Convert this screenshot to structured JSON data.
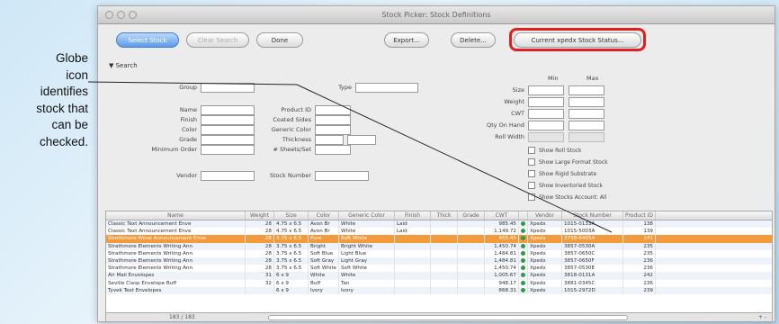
{
  "callout": {
    "lines": [
      "Globe",
      "icon",
      "identifies",
      "stock that",
      "can be",
      "checked."
    ]
  },
  "window": {
    "title": "Stock Picker: Stock Definitions"
  },
  "toolbar": {
    "select_stock": "Select Stock",
    "clear_search": "Clear Search",
    "done": "Done",
    "export": "Export...",
    "delete": "Delete...",
    "current_status": "Current xpedx Stock Status..."
  },
  "search": {
    "toggle": "▼ Search",
    "min_header": "Min",
    "max_header": "Max",
    "labels": {
      "group": "Group",
      "name": "Name",
      "finish": "Finish",
      "color": "Color",
      "grade": "Grade",
      "minimum_order": "Minimum Order",
      "vendor": "Vendor",
      "type": "Type",
      "product_id": "Product ID",
      "coated_sides": "Coated Sides",
      "generic_color": "Generic Color",
      "thickness": "Thickness",
      "sheets_per": "# Sheets/Set",
      "stock_number": "Stock Number",
      "size": "Size",
      "weight": "Weight",
      "cwt": "CWT",
      "qty_on_hand": "Qty On Hand",
      "roll_width": "Roll Width"
    },
    "checkboxes": [
      "Show Roll Stock",
      "Show Large Format Stock",
      "Show Rigid Substrate",
      "Show Inventoried Stock",
      "Show Stocks Account: All"
    ]
  },
  "table": {
    "columns": [
      "Name",
      "Weight",
      "Size",
      "Color",
      "Generic Color",
      "Finish",
      "Thick",
      "Grade",
      "CWT",
      "",
      "Vendor",
      "Stock Number",
      "Product ID"
    ],
    "rows": [
      [
        "Classic Text Announcement Enve",
        "28",
        "4.75 x 6.5",
        "Avon Br",
        "White",
        "Laid",
        "",
        "",
        "985.45",
        "globe",
        "Xpedx",
        "1015-0133A",
        "138",
        "alt"
      ],
      [
        "Classic Text Announcement Enve",
        "28",
        "4.75 x 6.5",
        "Avon Br",
        "White",
        "Laid",
        "",
        "",
        "1,149.72",
        "globe",
        "Xpedx",
        "1015-5003A",
        "139",
        ""
      ],
      [
        "Strathmore Wove Announcement Enve",
        "28",
        "3.75 x 6.5",
        "Pure",
        "Soft White",
        "",
        "",
        "",
        "955.45",
        "globe",
        "Xpedx",
        "3758-0405A",
        "141",
        "sel"
      ],
      [
        "Strathmore Elements Writing Ann",
        "28",
        "3.75 x 6.5",
        "Bright",
        "Bright White",
        "",
        "",
        "",
        "1,450.74",
        "globe",
        "Xpedx",
        "3857-0530A",
        "235",
        "alt"
      ],
      [
        "Strathmore Elements Writing Ann",
        "28",
        "3.75 x 6.5",
        "Soft Blue",
        "Light Blue",
        "",
        "",
        "",
        "1,484.81",
        "globe",
        "Xpedx",
        "3857-0650C",
        "235",
        ""
      ],
      [
        "Strathmore Elements Writing Ann",
        "28",
        "3.75 x 6.5",
        "Soft Gray",
        "Light Gray",
        "",
        "",
        "",
        "1,484.81",
        "globe",
        "Xpedx",
        "3857-0650F",
        "236",
        "alt"
      ],
      [
        "Strathmore Elements Writing Ann",
        "28",
        "3.75 x 6.5",
        "Soft White",
        "Soft White",
        "",
        "",
        "",
        "1,450.74",
        "globe",
        "Xpedx",
        "3857-0530E",
        "236",
        ""
      ],
      [
        "Air Mail Envelopes",
        "31",
        "6 x 9",
        "White",
        "White",
        "",
        "",
        "",
        "1,005.67",
        "globe",
        "Xpedx",
        "3818-0131A",
        "242",
        "alt"
      ],
      [
        "Seville Clasp Envelope Buff",
        "32",
        "6 x 9",
        "Buff",
        "Tan",
        "",
        "",
        "",
        "948.17",
        "globe",
        "Xpedx",
        "3881-0345C",
        "236",
        ""
      ],
      [
        "Tyvek Text Envelopes",
        "",
        "6 x 9",
        "Ivory",
        "Ivory",
        "",
        "",
        "",
        "868.31",
        "globe",
        "Xpedx",
        "1015-2972D",
        "239",
        "alt"
      ]
    ],
    "footer_count": "183 / 183",
    "footer_pm": "+ -"
  },
  "colors": {
    "highlight": "#e02020",
    "selected_row": "#f39a3c",
    "globe": "#2e9a4a"
  }
}
